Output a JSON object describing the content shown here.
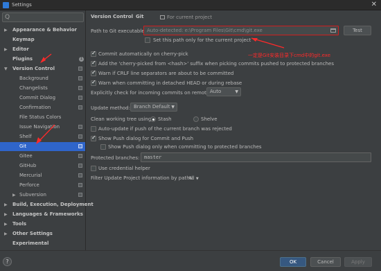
{
  "window": {
    "title": "Settings",
    "close": "✕"
  },
  "sidebar": {
    "search_icon": "Q",
    "items": [
      {
        "label": "Appearance & Behavior",
        "arrow": "▶"
      },
      {
        "label": "Keymap"
      },
      {
        "label": "Editor",
        "arrow": "▶"
      },
      {
        "label": "Plugins",
        "badge": "1"
      },
      {
        "label": "Version Control",
        "arrow": "▼"
      },
      {
        "label": "Background"
      },
      {
        "label": "Changelists"
      },
      {
        "label": "Commit Dialog"
      },
      {
        "label": "Confirmation"
      },
      {
        "label": "File Status Colors"
      },
      {
        "label": "Issue Navigation"
      },
      {
        "label": "Shelf"
      },
      {
        "label": "Git"
      },
      {
        "label": "Gitee"
      },
      {
        "label": "GitHub"
      },
      {
        "label": "Mercurial"
      },
      {
        "label": "Perforce"
      },
      {
        "label": "Subversion",
        "arrow": "▶"
      },
      {
        "label": "Build, Execution, Deployment",
        "arrow": "▶"
      },
      {
        "label": "Languages & Frameworks",
        "arrow": "▶"
      },
      {
        "label": "Tools",
        "arrow": "▶"
      },
      {
        "label": "Other Settings",
        "arrow": "▶"
      },
      {
        "label": "Experimental"
      }
    ]
  },
  "breadcrumb": {
    "parent": "Version Control",
    "sep": "›",
    "current": "Git",
    "scope": "For current project"
  },
  "git": {
    "path_label": "Path to Git executable:",
    "path_value": "Auto-detected: e:\\Program Files\\Git\\cmd\\git.exe",
    "test_button": "Test",
    "set_path_only": "Set this path only for the current project",
    "commit_cherry_pick": "Commit automatically on cherry-pick",
    "add_cherry_picked": "Add the 'cherry-picked from <hash>' suffix when picking commits pushed to protected branches",
    "warn_crlf": "Warn if CRLF line separators are about to be committed",
    "warn_detached": "Warn when committing in detached HEAD or during rebase",
    "explicit_check_label": "Explicitly check for incoming commits on remotes:",
    "explicit_check_value": "Auto",
    "update_method_label": "Update method:",
    "update_method_value": "Branch Default",
    "clean_tree_label": "Clean working tree using:",
    "stash": "Stash",
    "shelve": "Shelve",
    "auto_update": "Auto-update if push of the current branch was rejected",
    "show_push_dialog": "Show Push dialog for Commit and Push",
    "show_push_protected": "Show Push dialog only when committing to protected branches",
    "protected_label": "Protected branches:",
    "protected_value": "master",
    "use_credential": "Use credential helper",
    "filter_label": "Filter Update Project information by paths:",
    "filter_value": "All"
  },
  "annotation": "一定是Git安装目录下cmd中的git.exe",
  "footer": {
    "ok": "OK",
    "cancel": "Cancel",
    "apply": "Apply",
    "help": "?"
  },
  "colors": {
    "selected": "#2f65ca",
    "annotation": "#ff2a2a",
    "primary": "#365880"
  }
}
